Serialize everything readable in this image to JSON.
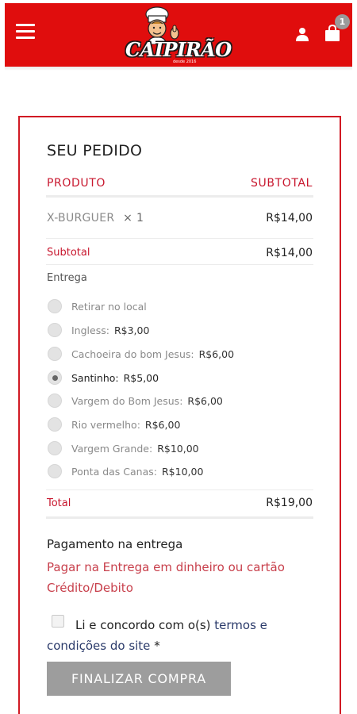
{
  "header": {
    "brand": "CAIPIRÃO",
    "brand_tagline": "desde 2016",
    "cart_count": "1",
    "colors": {
      "header_bg": "#e00d0d",
      "accent": "#c8172e",
      "border": "#d11a24"
    }
  },
  "order": {
    "title": "SEU PEDIDO",
    "col_product": "PRODUTO",
    "col_subtotal": "SUBTOTAL",
    "item": {
      "name": "X-BURGUER",
      "qty": "× 1",
      "price": "R$14,00"
    },
    "subtotal_label": "Subtotal",
    "subtotal_value": "R$14,00",
    "shipping_label": "Entrega",
    "shipping_options": [
      {
        "label": "Retirar no local",
        "price": "",
        "selected": false
      },
      {
        "label": "Ingless:",
        "price": "R$3,00",
        "selected": false
      },
      {
        "label": "Cachoeira do bom Jesus:",
        "price": "R$6,00",
        "selected": false
      },
      {
        "label": "Santinho:",
        "price": "R$5,00",
        "selected": true
      },
      {
        "label": "Vargem do Bom Jesus:",
        "price": "R$6,00",
        "selected": false
      },
      {
        "label": "Rio vermelho:",
        "price": "R$6,00",
        "selected": false
      },
      {
        "label": "Vargem Grande:",
        "price": "R$10,00",
        "selected": false
      },
      {
        "label": "Ponta das Canas:",
        "price": "R$10,00",
        "selected": false
      }
    ],
    "total_label": "Total",
    "total_value": "R$19,00"
  },
  "payment": {
    "title": "Pagamento na entrega",
    "description": "Pagar na Entrega em dinheiro ou cartão Crédito/Debito"
  },
  "terms": {
    "prefix": "Li e concordo com o(s) ",
    "link": "termos e condições do site",
    "suffix": " *",
    "checked": false
  },
  "actions": {
    "finalize": "FINALIZAR COMPRA"
  }
}
